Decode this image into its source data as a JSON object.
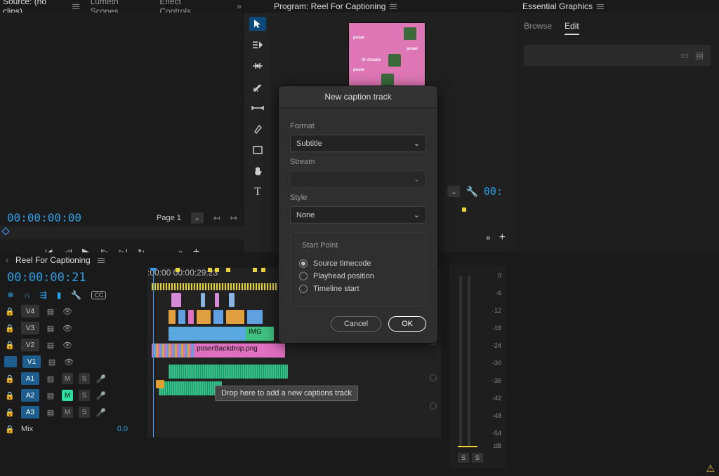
{
  "tabs_top_left": [
    "Source: (no clips)",
    "Lumetri Scopes",
    "Effect Controls"
  ],
  "program_tab": "Program: Reel For Captioning",
  "essential_tab": "Essential Graphics",
  "eg_tabs": {
    "browse": "Browse",
    "edit": "Edit"
  },
  "source": {
    "timecode": "00:00:00:00",
    "page_label": "Page 1"
  },
  "program": {
    "timecode_suffix": "00:"
  },
  "timeline": {
    "sequence_name": "Reel For Captioning",
    "timecode": "00:00:00:21",
    "ruler": {
      "t0": ":00:00",
      "t1": "00:00:29:23"
    },
    "tracks_v": [
      "V4",
      "V3",
      "V2",
      "V1"
    ],
    "tracks_a": [
      "A1",
      "A2",
      "A3"
    ],
    "mix_label": "Mix",
    "mix_level": "0.0",
    "clip_label": "poserBackdrop.png",
    "clip_label2": "IMG",
    "tooltip": "Drop here to add a new captions track"
  },
  "meter": {
    "ticks": [
      "0",
      "-6",
      "-12",
      "-18",
      "-24",
      "-30",
      "-36",
      "-42",
      "-48",
      "-54"
    ],
    "unit": "dB",
    "s": "S"
  },
  "dialog": {
    "title": "New caption track",
    "format_label": "Format",
    "format_value": "Subtitle",
    "stream_label": "Stream",
    "style_label": "Style",
    "style_value": "None",
    "startpoint_label": "Start Point",
    "radio_source": "Source timecode",
    "radio_playhead": "Playhead position",
    "radio_timeline": "Timeline start",
    "cancel": "Cancel",
    "ok": "OK"
  },
  "icons": {
    "selection": "selection",
    "trackfwd": "track-select",
    "ripple": "ripple-edit",
    "razor": "razor",
    "slip": "slip",
    "pen": "pen",
    "rect": "rectangle",
    "hand": "hand",
    "type": "type",
    "wrench": "wrench",
    "cc": "CC"
  }
}
